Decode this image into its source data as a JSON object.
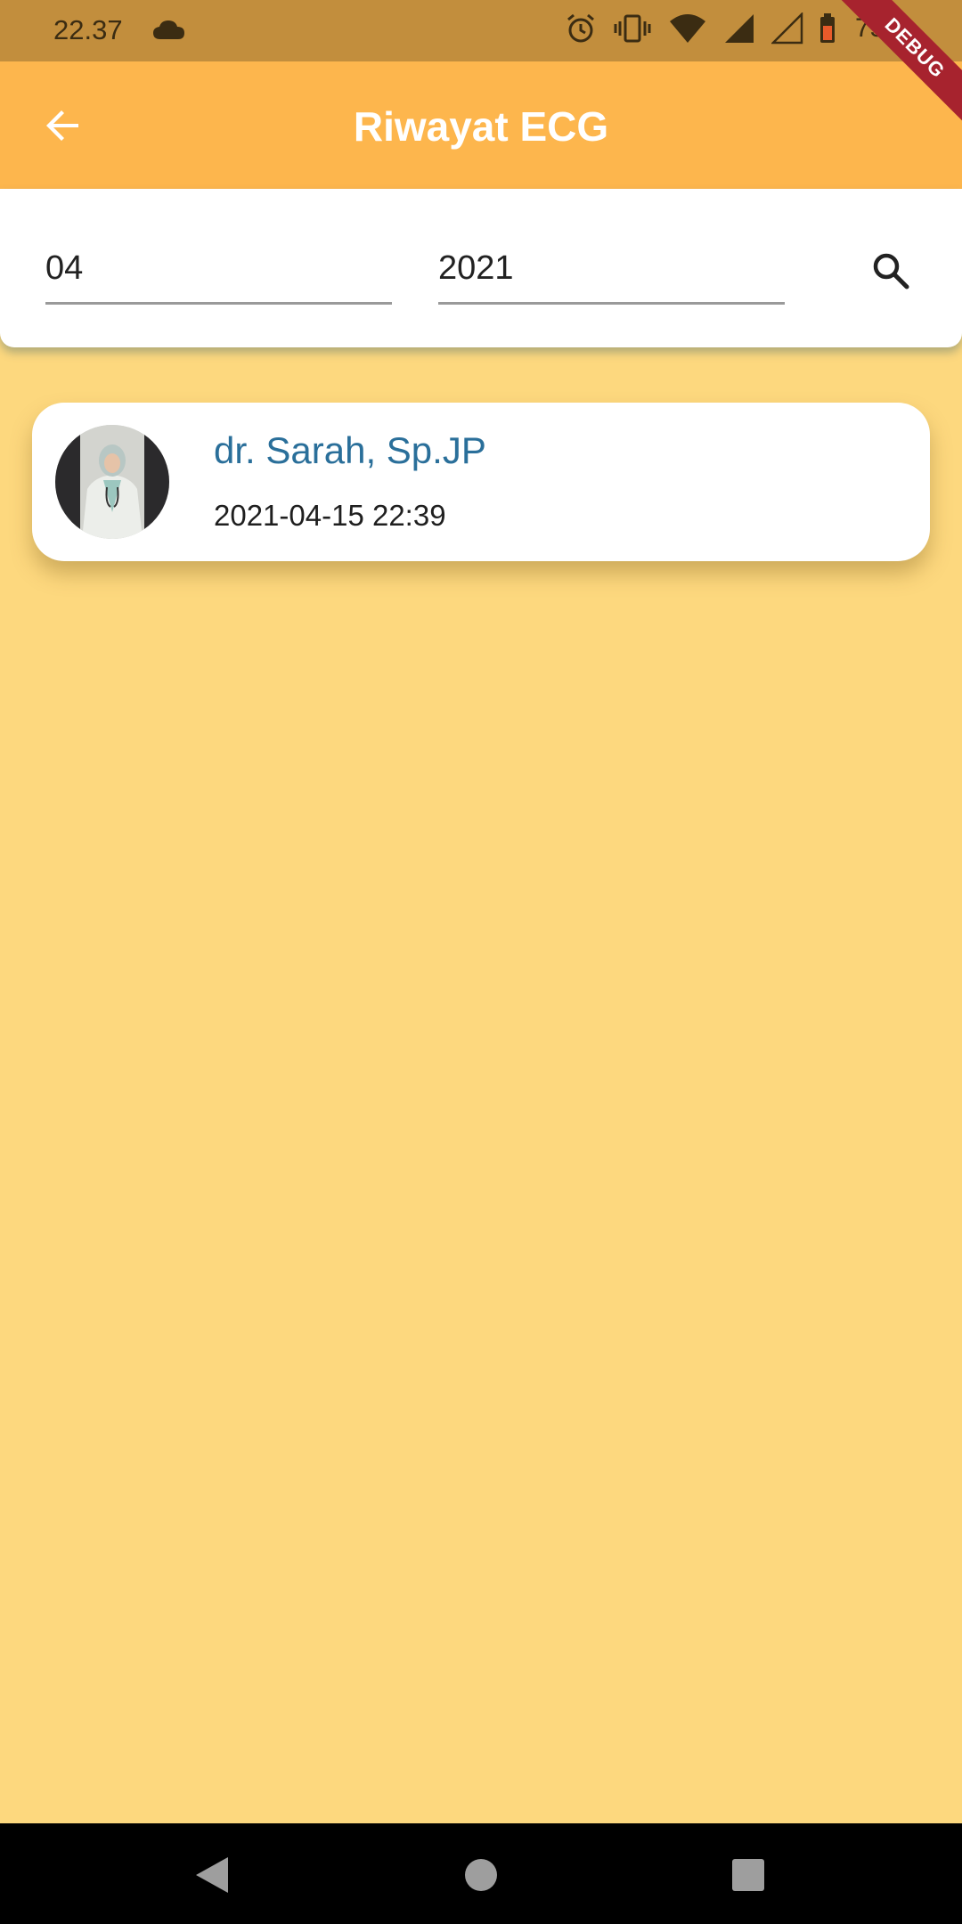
{
  "status_bar": {
    "time": "22.37",
    "battery": "75%",
    "icons": [
      "cloud-icon",
      "alarm-icon",
      "vibrate-icon",
      "wifi-icon",
      "signal-icon",
      "signal-empty-icon",
      "battery-icon"
    ]
  },
  "debug_banner": "DEBUG",
  "app_bar": {
    "title": "Riwayat ECG",
    "back_icon": "arrow-back-icon",
    "background": "#fdb64d"
  },
  "filter": {
    "month_value": "04",
    "year_value": "2021",
    "search_icon": "search-icon"
  },
  "history": [
    {
      "doctor_name": "dr. Sarah, Sp.JP",
      "datetime": "2021-04-15 22:39"
    }
  ],
  "colors": {
    "page_background": "#fdd87e",
    "doctor_name": "#2a6f9a",
    "status_bar": "#c28e3d"
  },
  "nav_bar": {
    "icons": [
      "nav-back-icon",
      "nav-home-icon",
      "nav-recent-icon"
    ]
  }
}
